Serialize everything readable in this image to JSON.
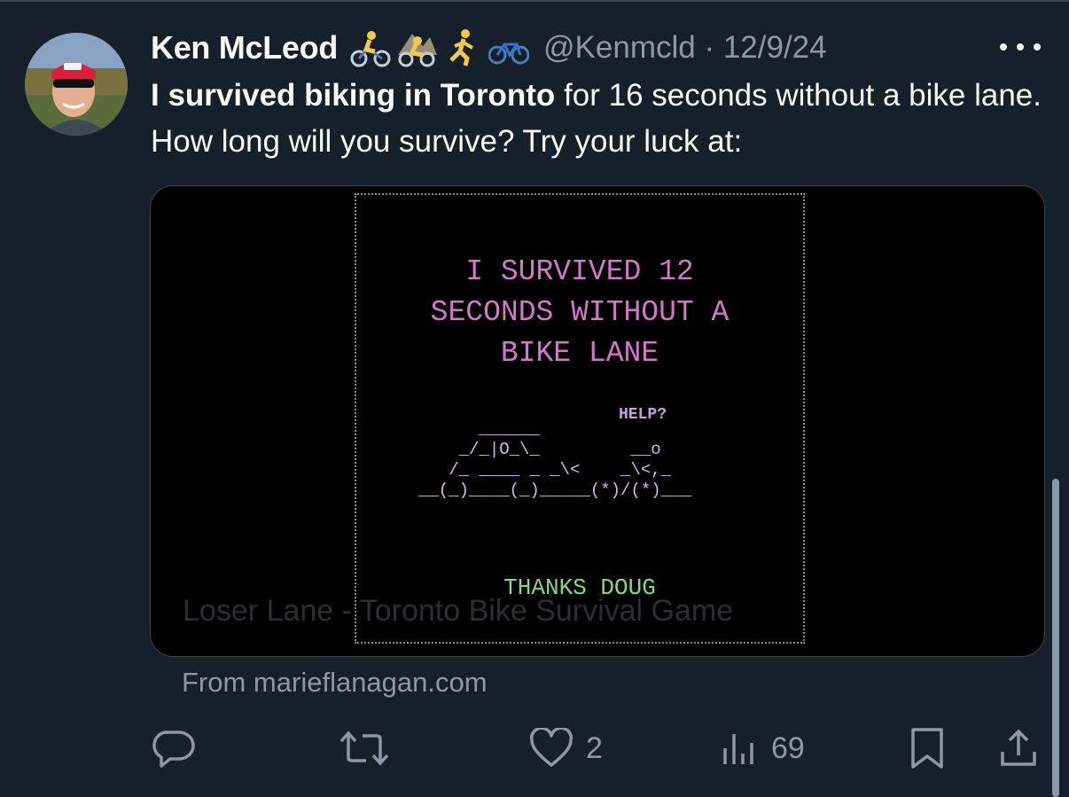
{
  "author": {
    "name": "Ken McLeod",
    "emojis": [
      "cyclist-emoji",
      "mountain-biker-emoji",
      "runner-emoji",
      "bicycle-emoji"
    ],
    "handle_line": "@Kenmcld · 12/9/24"
  },
  "tweet": {
    "bold_text": "I survived biking in Toronto",
    "text": " for 16 seconds without a bike lane. How long will you survive? Try your luck at:"
  },
  "card": {
    "game_title": "I SURVIVED 12\nSECONDS WITHOUT A\nBIKE LANE",
    "help": "HELP?",
    "ascii_art": "      ______\n    _/_|O_\\_         __o\n   /_ ____ _ _\\<    _\\<,_\n__(_)____(_)_____(*)/(*)___",
    "thanks": "THANKS DOUG",
    "link_title": "Loser Lane - Toronto Bike Survival Game",
    "source": "From marieflanagan.com"
  },
  "actions": {
    "reply_count": "",
    "retweet_count": "",
    "like_count": "2",
    "views_count": "69"
  },
  "colors": {
    "background": "#15202b",
    "text": "#f7f9f9",
    "muted": "#8b98a5",
    "game_pink": "#d377c8",
    "game_green": "#86d87e"
  }
}
